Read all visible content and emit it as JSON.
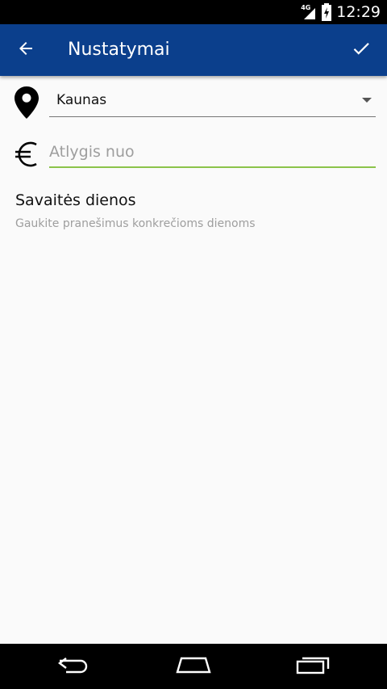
{
  "status_bar": {
    "network": "4G",
    "time": "12:29"
  },
  "toolbar": {
    "title": "Nustatymai",
    "back_icon": "arrow-back-icon",
    "done_icon": "checkmark-icon",
    "color": "#0b3f8c"
  },
  "settings": {
    "city": {
      "icon": "location-pin-icon",
      "value": "Kaunas"
    },
    "salary": {
      "icon": "euro-icon",
      "placeholder": "Atlygis nuo",
      "value": "",
      "accent": "#8bc34a"
    },
    "weekdays": {
      "title": "Savaitės dienos",
      "subtitle": "Gaukite pranešimus konkrečioms dienoms"
    }
  }
}
